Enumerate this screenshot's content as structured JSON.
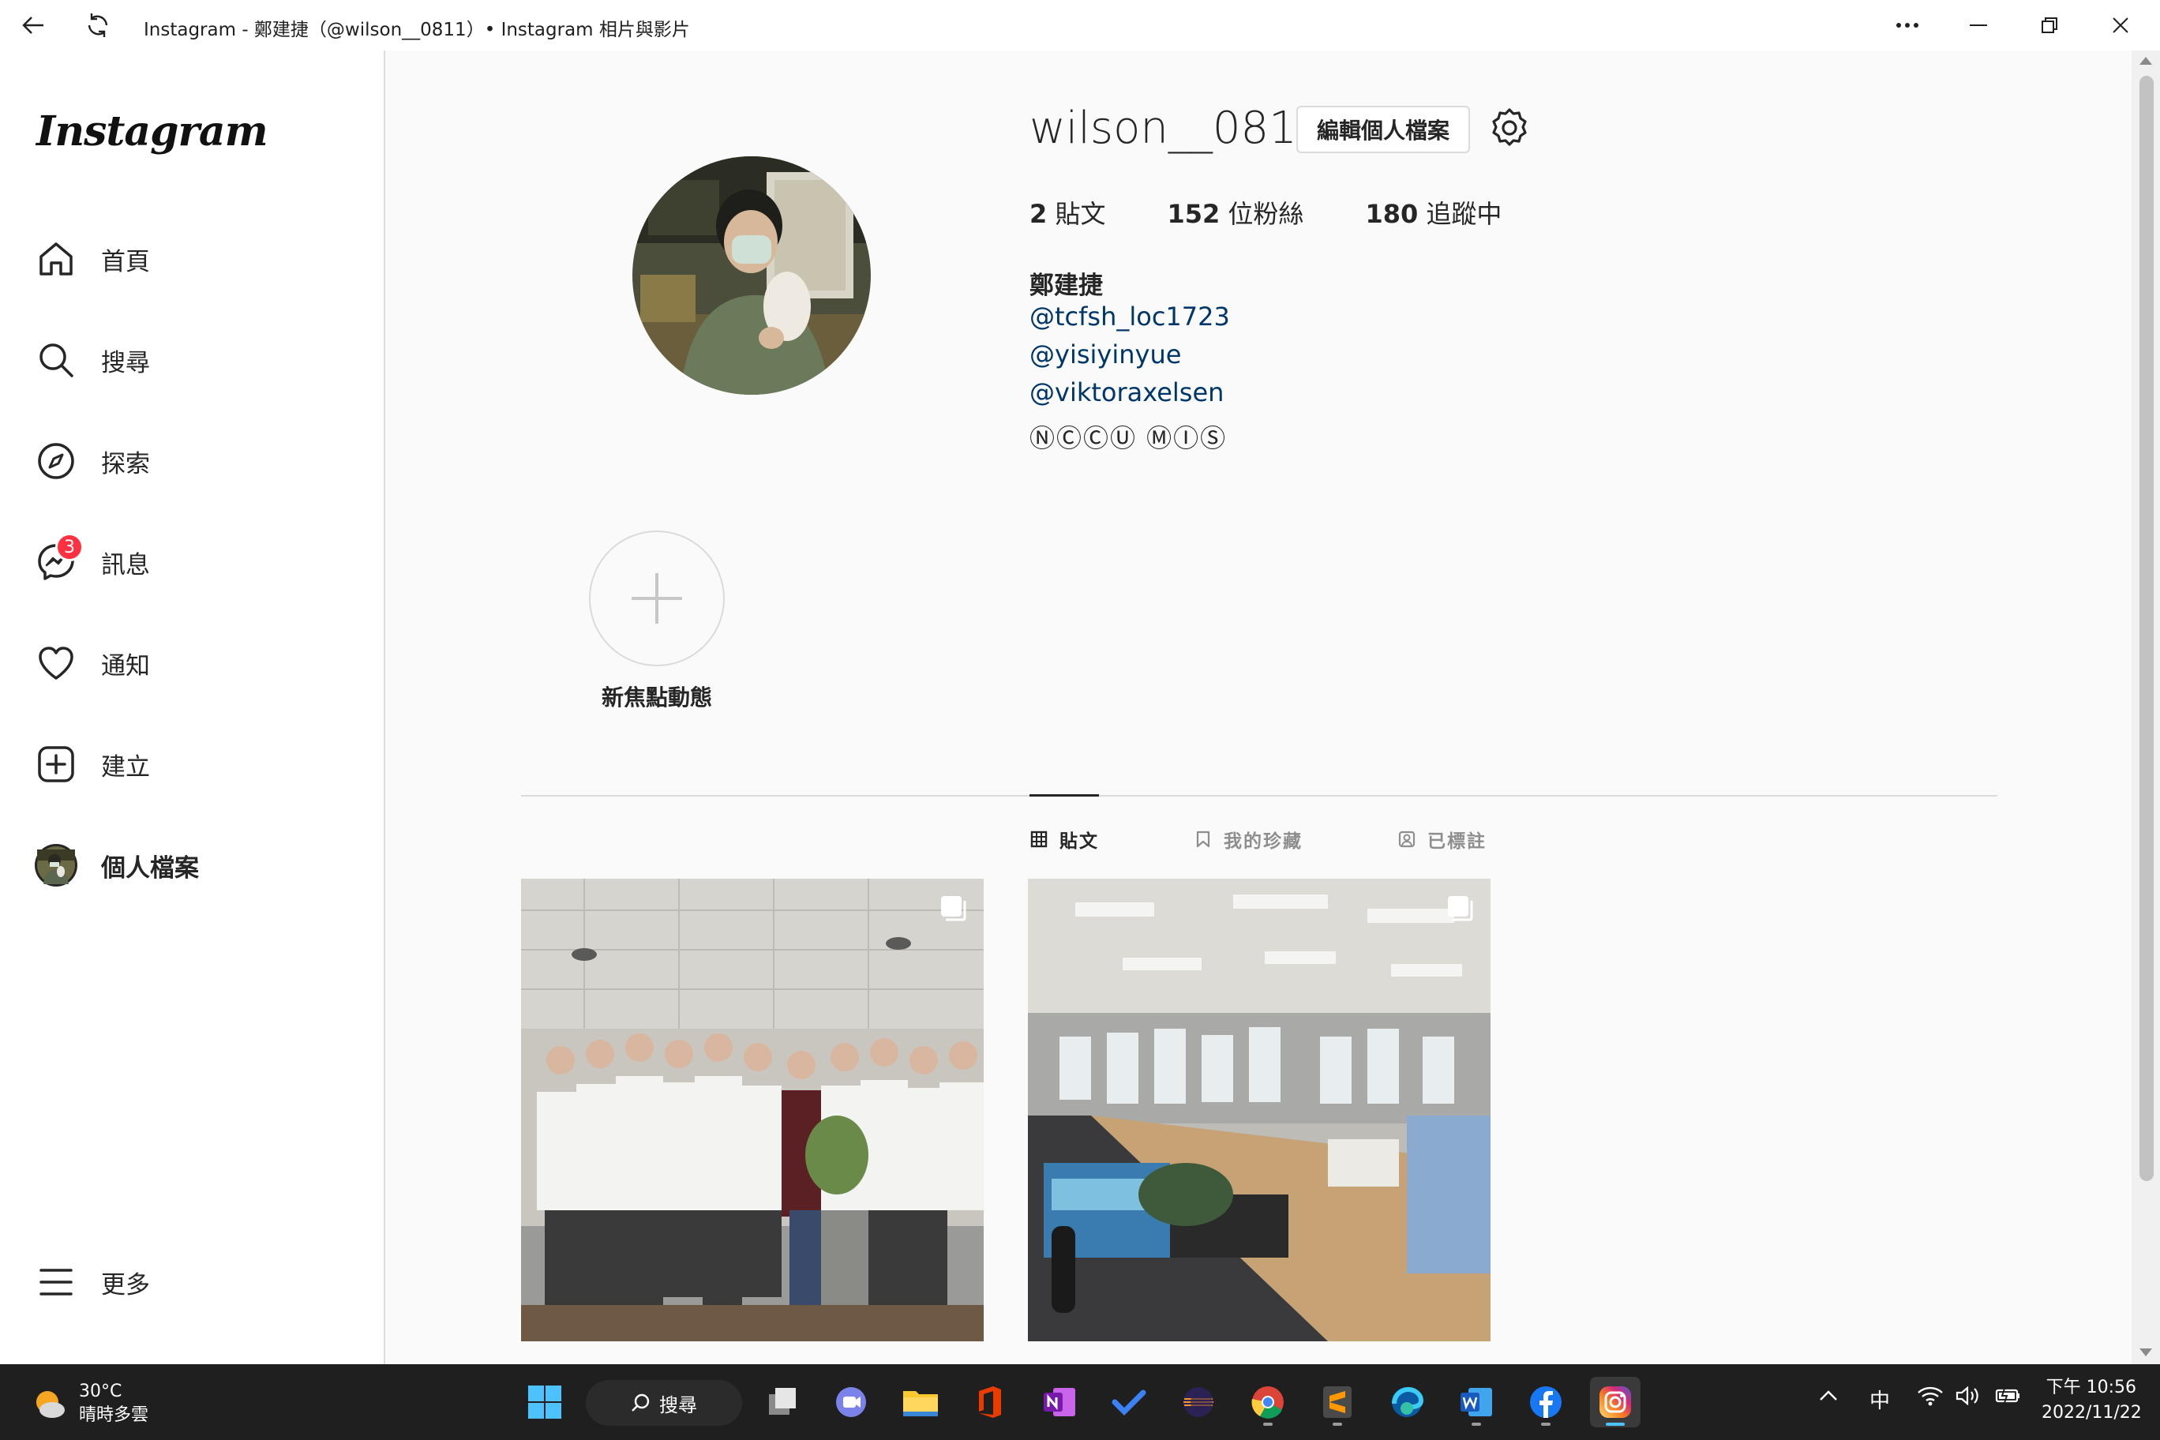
{
  "window": {
    "title": "Instagram - 鄭建捷（@wilson__0811）• Instagram 相片與影片"
  },
  "sidebar": {
    "logo": "Instagram",
    "items": [
      {
        "label": "首頁",
        "icon": "home-icon"
      },
      {
        "label": "搜尋",
        "icon": "search-icon"
      },
      {
        "label": "探索",
        "icon": "compass-icon"
      },
      {
        "label": "訊息",
        "icon": "messenger-icon",
        "badge": "3"
      },
      {
        "label": "通知",
        "icon": "heart-icon"
      },
      {
        "label": "建立",
        "icon": "plus-square-icon"
      },
      {
        "label": "個人檔案",
        "icon": "avatar"
      }
    ],
    "more_label": "更多"
  },
  "profile": {
    "username": "wilson__0811",
    "edit_button": "編輯個人檔案",
    "stats": {
      "posts_count": "2",
      "posts_label": "貼文",
      "followers_count": "152",
      "followers_label": "位粉絲",
      "following_count": "180",
      "following_label": "追蹤中"
    },
    "full_name": "鄭建捷",
    "bio_links": [
      "@tcfsh_loc1723",
      "@yisiyinyue",
      "@viktoraxelsen"
    ],
    "bio_text": "ⓃⒸⒸⓊ ⓂⒾⓈ"
  },
  "highlight": {
    "label": "新焦點動態"
  },
  "tabs": [
    {
      "label": "貼文",
      "icon": "grid-icon",
      "active": true
    },
    {
      "label": "我的珍藏",
      "icon": "bookmark-icon",
      "active": false
    },
    {
      "label": "已標註",
      "icon": "tagged-icon",
      "active": false
    }
  ],
  "taskbar": {
    "weather_temp": "30°C",
    "weather_desc": "晴時多雲",
    "search_label": "搜尋",
    "ime": "中",
    "time": "下午 10:56",
    "date": "2022/11/22"
  },
  "colors": {
    "link": "#00376b",
    "badge": "#ff3040",
    "taskbar": "#1f1f1f"
  }
}
